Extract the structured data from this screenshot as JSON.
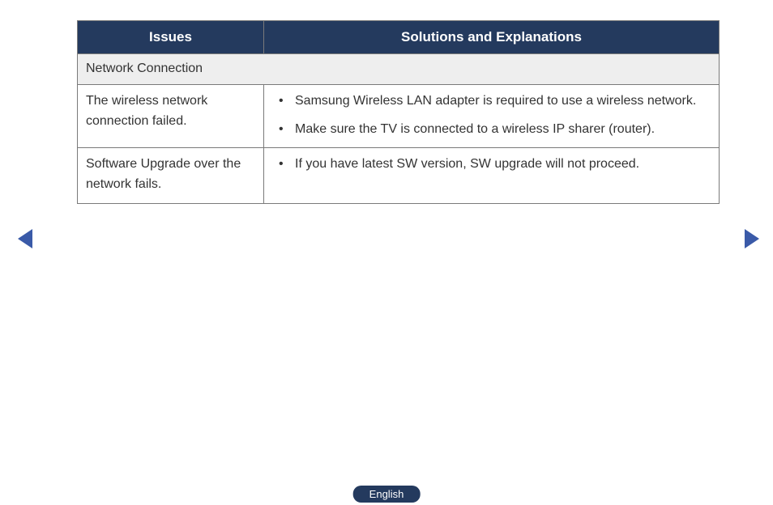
{
  "table": {
    "headers": {
      "issues": "Issues",
      "solutions": "Solutions and Explanations"
    },
    "section": "Network Connection",
    "rows": [
      {
        "issue": "The wireless network connection failed.",
        "solutions": [
          "Samsung Wireless LAN adapter is required to use a wireless network.",
          "Make sure the TV is connected to a wireless IP sharer (router)."
        ]
      },
      {
        "issue": "Software Upgrade over the network fails.",
        "solutions": [
          "If you have latest SW version, SW upgrade will not proceed."
        ]
      }
    ]
  },
  "language": "English"
}
